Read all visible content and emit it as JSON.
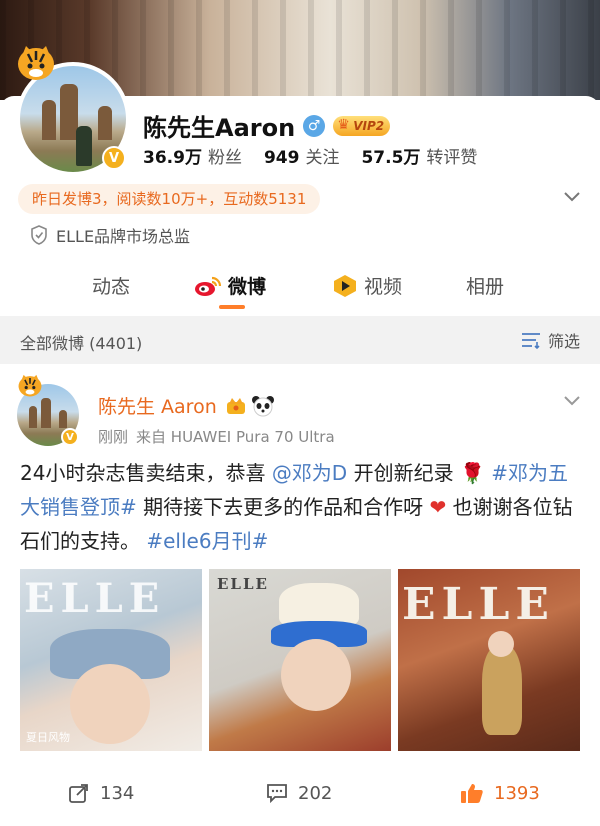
{
  "profile": {
    "name": "陈先生Aaron",
    "gender_icon": "♂",
    "vip_label": "VIP2",
    "verified_mark": "V",
    "stats": [
      {
        "value": "36.9万",
        "label": "粉丝"
      },
      {
        "value": "949",
        "label": "关注"
      },
      {
        "value": "57.5万",
        "label": "转评赞"
      }
    ],
    "highlight": "昨日发博3，阅读数10万+，互动数5131",
    "certification": "ELLE品牌市场总监"
  },
  "tabs": [
    {
      "label": "动态",
      "active": false
    },
    {
      "label": "微博",
      "active": true
    },
    {
      "label": "视频",
      "active": false
    },
    {
      "label": "相册",
      "active": false
    }
  ],
  "feed": {
    "title": "全部微博 (4401)",
    "filter_label": "筛选"
  },
  "post": {
    "author": "陈先生 Aaron",
    "time": "刚刚",
    "source": "来自 HUAWEI Pura 70 Ultra",
    "text_1": "24小时杂志售卖结束，恭喜",
    "mention": "@邓为D",
    "text_2": " 开创新纪录 ",
    "emoji_rose": "🌹",
    "hashtag_1": "#邓为五大销售登顶#",
    "text_3": " 期待接下去更多的作品和合作呀",
    "emoji_heart": "❤",
    "text_4": "也谢谢各位钻石们的支持。",
    "hashtag_2": "#elle6月刊#",
    "images": [
      {
        "logo": "ELLE",
        "caption": "夏日风物"
      },
      {
        "logo": "ELLE",
        "caption": ""
      },
      {
        "logo": "ELLE",
        "caption": ""
      }
    ],
    "actions": {
      "repost": "134",
      "comment": "202",
      "like": "1393"
    }
  },
  "colors": {
    "accent": "#ff7e2a",
    "link": "#4b7cc1",
    "author": "#e8691f",
    "highlight_bg": "#fdf1e6"
  }
}
